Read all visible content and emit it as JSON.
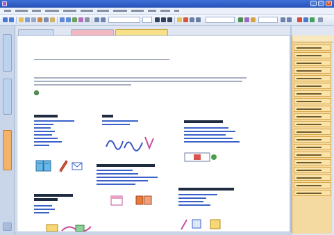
{
  "window": {
    "title": "",
    "minimize_glyph": "_",
    "maximize_glyph": "□",
    "close_glyph": "×"
  },
  "menu": {
    "items": [
      "",
      "",
      "",
      "",
      "",
      "",
      "",
      "",
      "",
      "",
      "",
      ""
    ]
  },
  "tabs": [
    {
      "label": "",
      "color": "#cfdcf0"
    },
    {
      "label": "",
      "color": "#f2b9c2"
    },
    {
      "label": "",
      "color": "#f7e08a"
    }
  ],
  "leftnav": [
    {
      "label": "",
      "color": "#bcd3f0"
    },
    {
      "label": "",
      "color": "#bcd3f0"
    },
    {
      "label": "",
      "color": "#f3b36b"
    }
  ],
  "page": {
    "title": ""
  },
  "sections": {
    "col1_heading": "",
    "col2_heading": "",
    "col3_heading": "",
    "col2b_heading": "",
    "col1b_heading": "",
    "col3b_heading": ""
  },
  "sidepanel": {
    "header": "",
    "items": [
      "",
      "",
      "",
      "",
      "",
      "",
      "",
      "",
      "",
      "",
      "",
      "",
      "",
      "",
      "",
      "",
      "",
      "",
      "",
      ""
    ]
  },
  "colors": {
    "accent": "#3a61c9",
    "panel": "#f4d9a0",
    "link": "#3a61c9"
  }
}
